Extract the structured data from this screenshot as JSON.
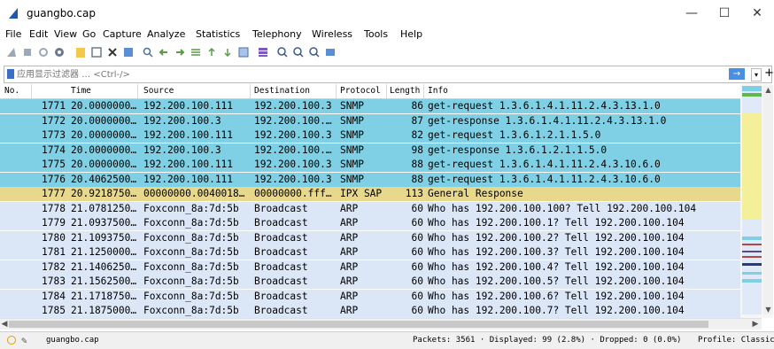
{
  "window": {
    "title": "guangbo.cap"
  },
  "menubar": {
    "items": [
      "File",
      "Edit",
      "View",
      "Go",
      "Capture",
      "Analyze",
      "Statistics",
      "Telephony",
      "Wireless",
      "Tools",
      "Help"
    ]
  },
  "filter": {
    "placeholder": "应用显示过滤器 … <Ctrl-/>"
  },
  "columns": {
    "no": "No.",
    "time": "Time",
    "source": "Source",
    "destination": "Destination",
    "protocol": "Protocol",
    "length": "Length",
    "info": "Info"
  },
  "packets": [
    {
      "no": "1771",
      "time": "20.0000000…",
      "source": "192.200.100.111",
      "destination": "192.200.100.3",
      "protocol": "SNMP",
      "length": "86",
      "info": "get-request 1.3.6.1.4.1.11.2.4.3.13.1.0",
      "color": "#7fd0e4"
    },
    {
      "no": "1772",
      "time": "20.0000000…",
      "source": "192.200.100.3",
      "destination": "192.200.100.…",
      "protocol": "SNMP",
      "length": "87",
      "info": "get-response 1.3.6.1.4.1.11.2.4.3.13.1.0",
      "color": "#7fd0e4"
    },
    {
      "no": "1773",
      "time": "20.0000000…",
      "source": "192.200.100.111",
      "destination": "192.200.100.3",
      "protocol": "SNMP",
      "length": "82",
      "info": "get-request 1.3.6.1.2.1.1.5.0",
      "color": "#7fd0e4"
    },
    {
      "no": "1774",
      "time": "20.0000000…",
      "source": "192.200.100.3",
      "destination": "192.200.100.…",
      "protocol": "SNMP",
      "length": "98",
      "info": "get-response 1.3.6.1.2.1.1.5.0",
      "color": "#7fd0e4"
    },
    {
      "no": "1775",
      "time": "20.0000000…",
      "source": "192.200.100.111",
      "destination": "192.200.100.3",
      "protocol": "SNMP",
      "length": "88",
      "info": "get-request 1.3.6.1.4.1.11.2.4.3.10.6.0",
      "color": "#7fd0e4"
    },
    {
      "no": "1776",
      "time": "20.4062500…",
      "source": "192.200.100.111",
      "destination": "192.200.100.3",
      "protocol": "SNMP",
      "length": "88",
      "info": "get-request 1.3.6.1.4.1.11.2.4.3.10.6.0",
      "color": "#7fd0e4"
    },
    {
      "no": "1777",
      "time": "20.9218750…",
      "source": "00000000.0040018…",
      "destination": "00000000.fff…",
      "protocol": "IPX SAP",
      "length": "113",
      "info": "General Response",
      "color": "#e8d88c"
    },
    {
      "no": "1778",
      "time": "21.0781250…",
      "source": "Foxconn_8a:7d:5b",
      "destination": "Broadcast",
      "protocol": "ARP",
      "length": "60",
      "info": "Who has 192.200.100.100? Tell 192.200.100.104",
      "color": "#dbe6f7"
    },
    {
      "no": "1779",
      "time": "21.0937500…",
      "source": "Foxconn_8a:7d:5b",
      "destination": "Broadcast",
      "protocol": "ARP",
      "length": "60",
      "info": "Who has 192.200.100.1? Tell 192.200.100.104",
      "color": "#dbe6f7"
    },
    {
      "no": "1780",
      "time": "21.1093750…",
      "source": "Foxconn_8a:7d:5b",
      "destination": "Broadcast",
      "protocol": "ARP",
      "length": "60",
      "info": "Who has 192.200.100.2? Tell 192.200.100.104",
      "color": "#dbe6f7"
    },
    {
      "no": "1781",
      "time": "21.1250000…",
      "source": "Foxconn_8a:7d:5b",
      "destination": "Broadcast",
      "protocol": "ARP",
      "length": "60",
      "info": "Who has 192.200.100.3? Tell 192.200.100.104",
      "color": "#dbe6f7"
    },
    {
      "no": "1782",
      "time": "21.1406250…",
      "source": "Foxconn_8a:7d:5b",
      "destination": "Broadcast",
      "protocol": "ARP",
      "length": "60",
      "info": "Who has 192.200.100.4? Tell 192.200.100.104",
      "color": "#dbe6f7"
    },
    {
      "no": "1783",
      "time": "21.1562500…",
      "source": "Foxconn_8a:7d:5b",
      "destination": "Broadcast",
      "protocol": "ARP",
      "length": "60",
      "info": "Who has 192.200.100.5? Tell 192.200.100.104",
      "color": "#dbe6f7"
    },
    {
      "no": "1784",
      "time": "21.1718750…",
      "source": "Foxconn_8a:7d:5b",
      "destination": "Broadcast",
      "protocol": "ARP",
      "length": "60",
      "info": "Who has 192.200.100.6? Tell 192.200.100.104",
      "color": "#dbe6f7"
    },
    {
      "no": "1785",
      "time": "21.1875000…",
      "source": "Foxconn_8a:7d:5b",
      "destination": "Broadcast",
      "protocol": "ARP",
      "length": "60",
      "info": "Who has 192.200.100.7? Tell 192.200.100.104",
      "color": "#dbe6f7"
    }
  ],
  "status": {
    "file": "guangbo.cap",
    "counts": "Packets: 3561 · Displayed: 99 (2.8%) · Dropped: 0 (0.0%)",
    "profile": "Profile: Classic"
  },
  "icons": {
    "window": [
      "minimize-icon",
      "maximize-icon",
      "close-icon"
    ],
    "toolbar": [
      "shark-fin-icon",
      "stop-icon",
      "restart-icon",
      "options-icon",
      "open-icon",
      "save-icon",
      "close-file-icon",
      "reload-icon",
      "find-icon",
      "back-icon",
      "forward-icon",
      "goto-icon",
      "first-icon",
      "last-icon",
      "autoscroll-icon",
      "colorize-icon",
      "zoom-in-icon",
      "zoom-out-icon",
      "zoom-normal-icon",
      "resize-columns-icon"
    ]
  }
}
